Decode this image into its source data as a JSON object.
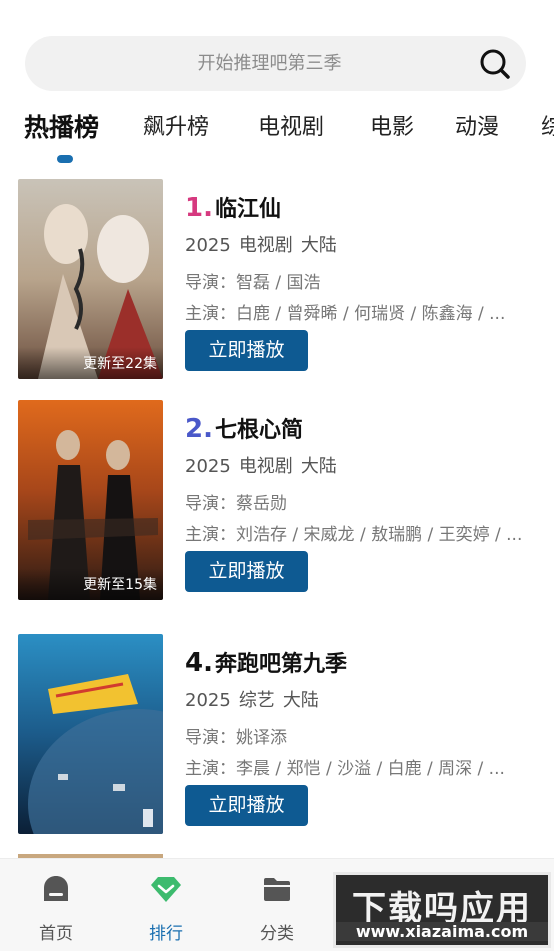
{
  "search": {
    "placeholder": "开始推理吧第三季"
  },
  "tabs": [
    {
      "label": "热播榜",
      "active": true
    },
    {
      "label": "飙升榜"
    },
    {
      "label": "电视剧"
    },
    {
      "label": "电影"
    },
    {
      "label": "动漫"
    },
    {
      "label": "综"
    }
  ],
  "items": [
    {
      "rank": "1.",
      "rank_color": "#d6397f",
      "title": "临江仙",
      "year": "2025",
      "type": "电视剧",
      "region": "大陆",
      "director": "导演：智磊 / 国浩",
      "cast": "主演：白鹿 / 曾舜晞 / 何瑞贤 / 陈鑫海 / ...",
      "update": "更新至22集",
      "play_label": "立即播放"
    },
    {
      "rank": "2.",
      "rank_color": "#4a58c9",
      "title": "七根心简",
      "year": "2025",
      "type": "电视剧",
      "region": "大陆",
      "director": "导演：蔡岳勋",
      "cast": "主演：刘浩存 / 宋威龙 / 敖瑞鹏 / 王奕婷 / ...",
      "update": "更新至15集",
      "play_label": "立即播放"
    },
    {
      "rank": "4.",
      "rank_color": "#111111",
      "title": "奔跑吧第九季",
      "year": "2025",
      "type": "综艺",
      "region": "大陆",
      "director": "导演：姚译添",
      "cast": "主演：李晨 / 郑恺 / 沙溢 / 白鹿 / 周深 / ...",
      "update": "",
      "play_label": "立即播放"
    }
  ],
  "bottom_nav": [
    {
      "label": "首页",
      "icon": "home-icon"
    },
    {
      "label": "排行",
      "icon": "ranking-icon",
      "active": true
    },
    {
      "label": "分类",
      "icon": "folder-icon"
    }
  ],
  "watermark": {
    "top": "下载吗应用",
    "bottom": "www.xiazaima.com"
  },
  "colors": {
    "accent": "#1a6fb0",
    "button": "#0e5a92"
  }
}
